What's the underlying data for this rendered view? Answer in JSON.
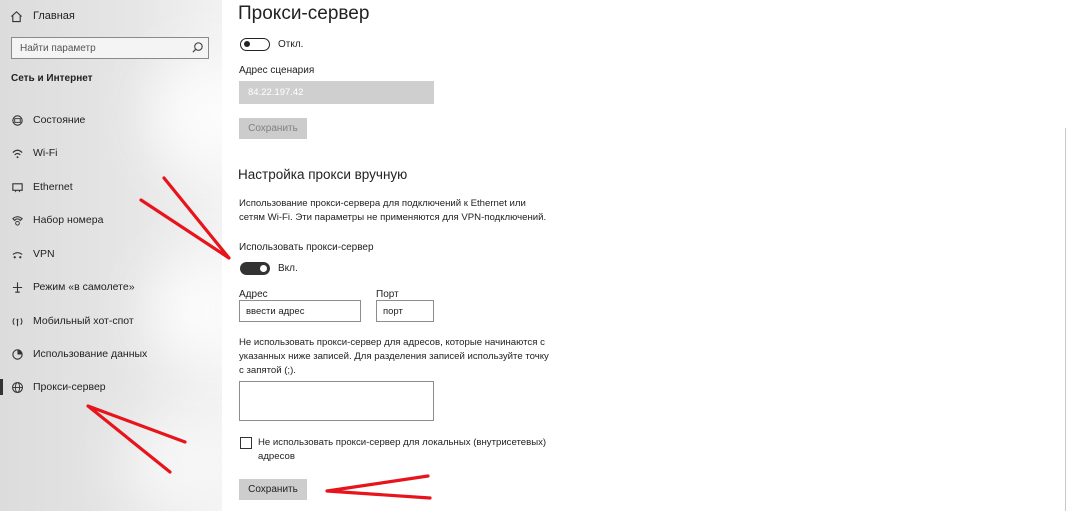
{
  "sidebar": {
    "home_label": "Главная",
    "search_placeholder": "Найти параметр",
    "section_title": "Сеть и Интернет",
    "items": [
      {
        "label": "Состояние",
        "icon": "status-icon"
      },
      {
        "label": "Wi-Fi",
        "icon": "wifi-icon"
      },
      {
        "label": "Ethernet",
        "icon": "ethernet-icon"
      },
      {
        "label": "Набор номера",
        "icon": "dialup-icon"
      },
      {
        "label": "VPN",
        "icon": "vpn-icon"
      },
      {
        "label": "Режим «в самолете»",
        "icon": "airplane-icon"
      },
      {
        "label": "Мобильный хот-спот",
        "icon": "hotspot-icon"
      },
      {
        "label": "Использование данных",
        "icon": "data-usage-icon"
      },
      {
        "label": "Прокси-сервер",
        "icon": "globe-icon",
        "active": true
      }
    ]
  },
  "main": {
    "title": "Прокси-сервер",
    "auto": {
      "toggle_state": "Откл.",
      "script_label": "Адрес сценария",
      "script_value": "84.22.197.42",
      "save_label": "Сохранить"
    },
    "manual": {
      "heading": "Настройка прокси вручную",
      "description_line1": "Использование прокси-сервера для подключений к Ethernet или",
      "description_line2": "сетям Wi-Fi. Эти параметры не применяются для VPN-подключений.",
      "use_proxy_label": "Использовать прокси-сервер",
      "toggle_state": "Вкл.",
      "address_label": "Адрес",
      "address_value": "ввести адрес",
      "port_label": "Порт",
      "port_value": "порт",
      "exceptions_line1": "Не использовать прокси-сервер для адресов, которые начинаются с",
      "exceptions_line2": "указанных ниже записей. Для разделения записей используйте точку",
      "exceptions_line3": "с запятой (;).",
      "checkbox_line1": "Не использовать прокси-сервер для локальных (внутрисетевых)",
      "checkbox_line2": "адресов",
      "save_label": "Сохранить"
    }
  },
  "colors": {
    "annotation": "#e8141c",
    "toggle_on": "#333333",
    "disabled_field": "#cfcfcf"
  }
}
